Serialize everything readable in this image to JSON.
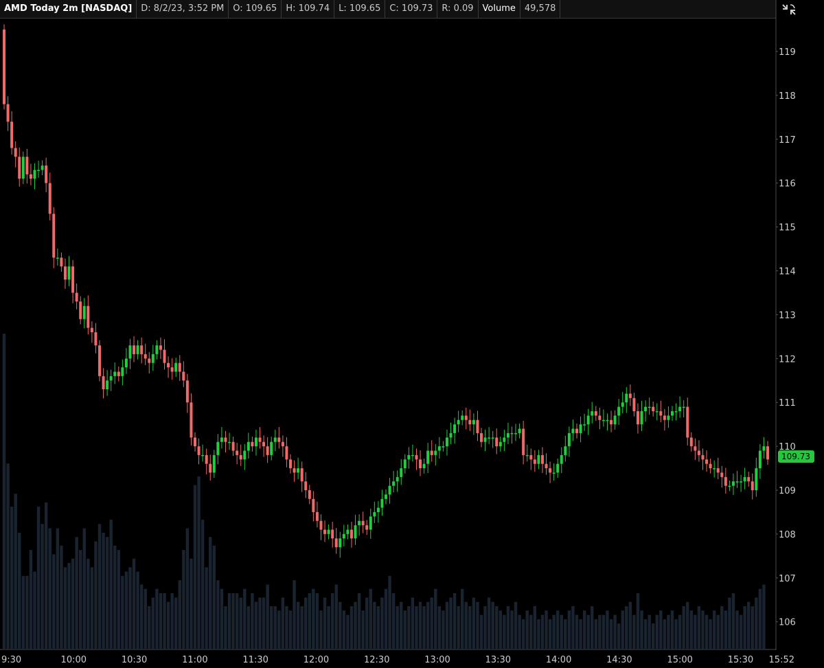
{
  "header": {
    "title": "AMD Today 2m [NASDAQ]",
    "date": "D: 8/2/23, 3:52 PM",
    "open": "O: 109.65",
    "high": "H: 109.74",
    "low": "L: 109.65",
    "close": "C: 109.73",
    "range": "R: 0.09",
    "volume_label": "Volume",
    "volume_value": "49,578"
  },
  "icons": {
    "toolbar": "crosshair-expand-icon"
  },
  "colors": {
    "up": "#1fcf3e",
    "down": "#f06a6a",
    "volume": "#1a2430",
    "background": "#000000",
    "last_badge": "#22c93a"
  },
  "chart_data": {
    "type": "candlestick",
    "title": "AMD Today 2m [NASDAQ]",
    "x_ticks": [
      "9:30",
      "10:00",
      "10:30",
      "11:00",
      "11:30",
      "12:00",
      "12:30",
      "13:00",
      "13:30",
      "14:00",
      "14:30",
      "15:00",
      "15:30",
      "15:52"
    ],
    "y_ticks": [
      119,
      118,
      117,
      116,
      115,
      114,
      113,
      112,
      111,
      110,
      109,
      108,
      107,
      106
    ],
    "ylim": [
      105.5,
      119.6
    ],
    "last_price": "109.73",
    "interval_minutes": 2,
    "closes": [
      117.8,
      117.4,
      116.8,
      116.6,
      116.1,
      116.6,
      116.2,
      116.1,
      116.3,
      116.3,
      116.4,
      116.0,
      115.3,
      114.3,
      114.3,
      114.1,
      113.8,
      114.1,
      113.5,
      113.3,
      112.9,
      113.2,
      112.7,
      112.6,
      112.3,
      111.6,
      111.3,
      111.5,
      111.6,
      111.7,
      111.6,
      111.8,
      112.0,
      112.3,
      112.1,
      112.3,
      112.1,
      112.0,
      111.9,
      112.1,
      112.3,
      112.2,
      111.9,
      111.8,
      111.7,
      111.9,
      111.7,
      111.5,
      111.0,
      110.2,
      110.0,
      109.8,
      109.8,
      109.6,
      109.4,
      109.8,
      110.1,
      110.2,
      110.1,
      110.1,
      109.9,
      109.8,
      109.7,
      109.9,
      110.1,
      110.0,
      110.2,
      110.1,
      110.0,
      109.8,
      110.1,
      110.2,
      110.1,
      110.0,
      109.7,
      109.5,
      109.4,
      109.5,
      109.2,
      109.0,
      108.8,
      108.5,
      108.3,
      108.1,
      108.0,
      108.1,
      107.9,
      107.7,
      107.9,
      108.0,
      108.1,
      107.9,
      108.2,
      108.3,
      108.2,
      108.1,
      108.4,
      108.5,
      108.6,
      108.8,
      108.9,
      109.1,
      109.2,
      109.3,
      109.5,
      109.7,
      109.8,
      109.8,
      109.7,
      109.5,
      109.6,
      109.9,
      109.8,
      109.9,
      110.0,
      110.0,
      110.2,
      110.3,
      110.5,
      110.6,
      110.7,
      110.6,
      110.5,
      110.6,
      110.3,
      110.1,
      110.2,
      110.2,
      110.2,
      110.0,
      110.1,
      110.2,
      110.3,
      110.3,
      110.3,
      110.4,
      109.8,
      109.8,
      109.7,
      109.6,
      109.8,
      109.6,
      109.5,
      109.4,
      109.4,
      109.6,
      109.8,
      110.0,
      110.3,
      110.4,
      110.3,
      110.5,
      110.5,
      110.7,
      110.8,
      110.7,
      110.6,
      110.6,
      110.6,
      110.5,
      110.7,
      110.9,
      111.0,
      111.2,
      111.1,
      110.8,
      110.5,
      110.8,
      110.9,
      110.9,
      110.8,
      110.8,
      110.7,
      110.6,
      110.7,
      110.8,
      110.8,
      110.9,
      110.9,
      110.2,
      110.0,
      109.9,
      109.8,
      109.7,
      109.6,
      109.5,
      109.5,
      109.4,
      109.3,
      109.1,
      109.1,
      109.2,
      109.2,
      109.2,
      109.3,
      109.2,
      109.0,
      109.5,
      109.9,
      110.0,
      109.7
    ],
    "volumes": [
      0.73,
      0.43,
      0.33,
      0.36,
      0.27,
      0.17,
      0.17,
      0.23,
      0.18,
      0.33,
      0.29,
      0.34,
      0.28,
      0.22,
      0.28,
      0.24,
      0.19,
      0.2,
      0.21,
      0.26,
      0.23,
      0.28,
      0.21,
      0.19,
      0.25,
      0.29,
      0.27,
      0.26,
      0.3,
      0.24,
      0.23,
      0.17,
      0.18,
      0.19,
      0.21,
      0.18,
      0.15,
      0.14,
      0.1,
      0.12,
      0.14,
      0.13,
      0.13,
      0.11,
      0.13,
      0.12,
      0.16,
      0.23,
      0.28,
      0.21,
      0.38,
      0.4,
      0.3,
      0.19,
      0.26,
      0.24,
      0.16,
      0.14,
      0.1,
      0.13,
      0.13,
      0.13,
      0.12,
      0.14,
      0.1,
      0.13,
      0.11,
      0.12,
      0.12,
      0.15,
      0.1,
      0.1,
      0.09,
      0.12,
      0.1,
      0.09,
      0.16,
      0.11,
      0.1,
      0.12,
      0.13,
      0.14,
      0.13,
      0.09,
      0.12,
      0.1,
      0.13,
      0.15,
      0.11,
      0.09,
      0.08,
      0.1,
      0.11,
      0.13,
      0.09,
      0.12,
      0.14,
      0.11,
      0.1,
      0.12,
      0.14,
      0.17,
      0.13,
      0.1,
      0.11,
      0.09,
      0.1,
      0.12,
      0.1,
      0.11,
      0.1,
      0.11,
      0.12,
      0.14,
      0.1,
      0.09,
      0.11,
      0.12,
      0.13,
      0.1,
      0.14,
      0.11,
      0.1,
      0.12,
      0.11,
      0.08,
      0.1,
      0.12,
      0.11,
      0.1,
      0.09,
      0.08,
      0.1,
      0.09,
      0.11,
      0.08,
      0.07,
      0.09,
      0.08,
      0.1,
      0.07,
      0.08,
      0.09,
      0.07,
      0.08,
      0.09,
      0.08,
      0.07,
      0.09,
      0.1,
      0.08,
      0.07,
      0.09,
      0.08,
      0.1,
      0.07,
      0.08,
      0.08,
      0.09,
      0.07,
      0.08,
      0.06,
      0.09,
      0.1,
      0.11,
      0.08,
      0.13,
      0.09,
      0.07,
      0.08,
      0.06,
      0.08,
      0.09,
      0.07,
      0.08,
      0.09,
      0.07,
      0.08,
      0.1,
      0.11,
      0.09,
      0.08,
      0.1,
      0.09,
      0.08,
      0.07,
      0.09,
      0.08,
      0.1,
      0.09,
      0.12,
      0.13,
      0.09,
      0.08,
      0.1,
      0.11,
      0.1,
      0.12,
      0.14,
      0.15
    ]
  }
}
